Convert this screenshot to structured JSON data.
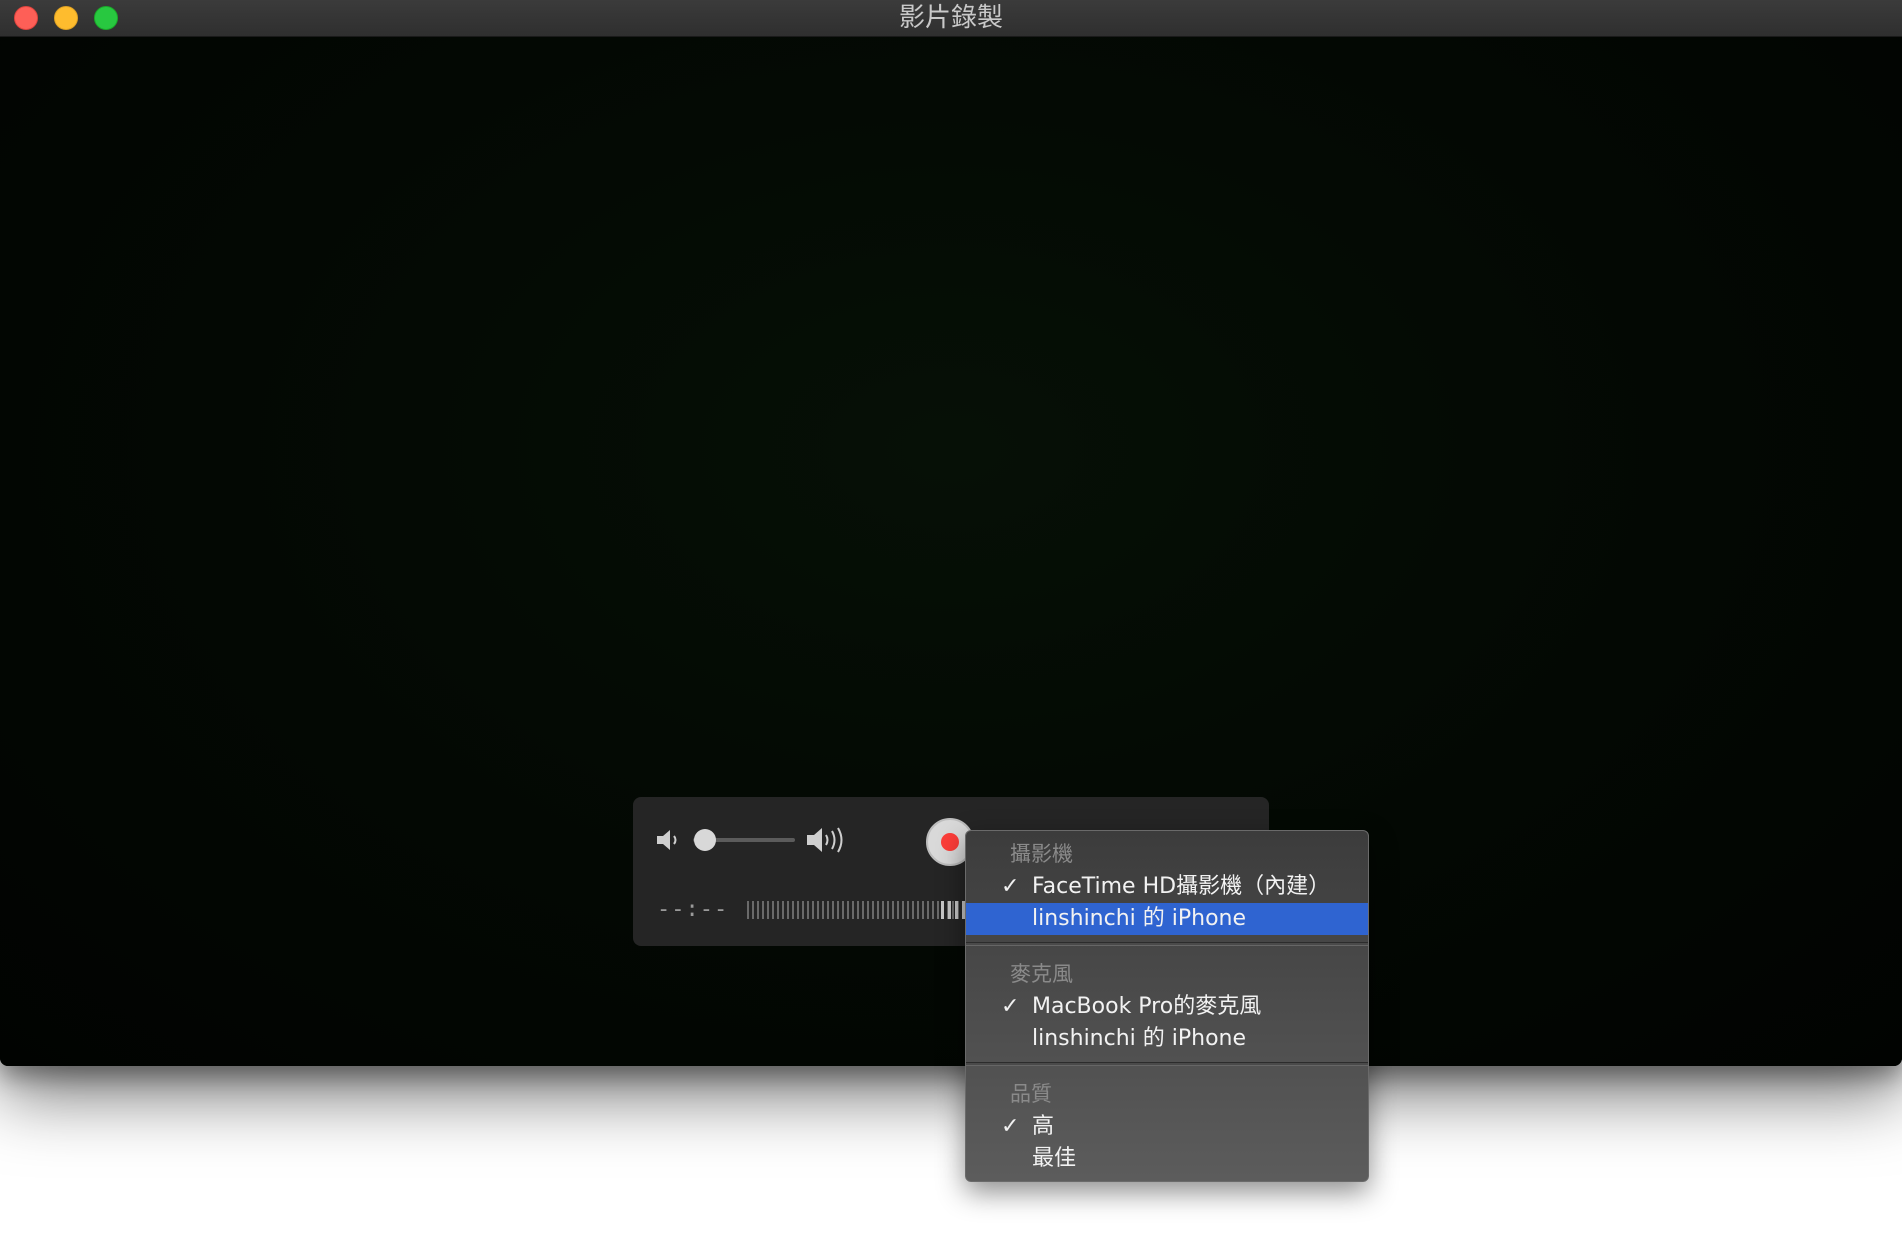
{
  "window": {
    "title": "影片錄製"
  },
  "hud": {
    "time": "--:--",
    "volume_level": 0.1
  },
  "menu": {
    "camera_header": "攝影機",
    "camera_items": [
      {
        "label": "FaceTime HD攝影機（內建）",
        "check": "✓"
      },
      {
        "label": "linshinchi 的 iPhone",
        "check": ""
      }
    ],
    "mic_header": "麥克風",
    "mic_items": [
      {
        "label": "MacBook Pro的麥克風",
        "check": "✓"
      },
      {
        "label": "linshinchi 的 iPhone",
        "check": ""
      }
    ],
    "quality_header": "品質",
    "quality_items": [
      {
        "label": "高",
        "check": "✓"
      },
      {
        "label": "最佳",
        "check": ""
      }
    ]
  },
  "colors": {
    "accent_selection": "#2f64d1",
    "record_red": "#fc3d39"
  }
}
